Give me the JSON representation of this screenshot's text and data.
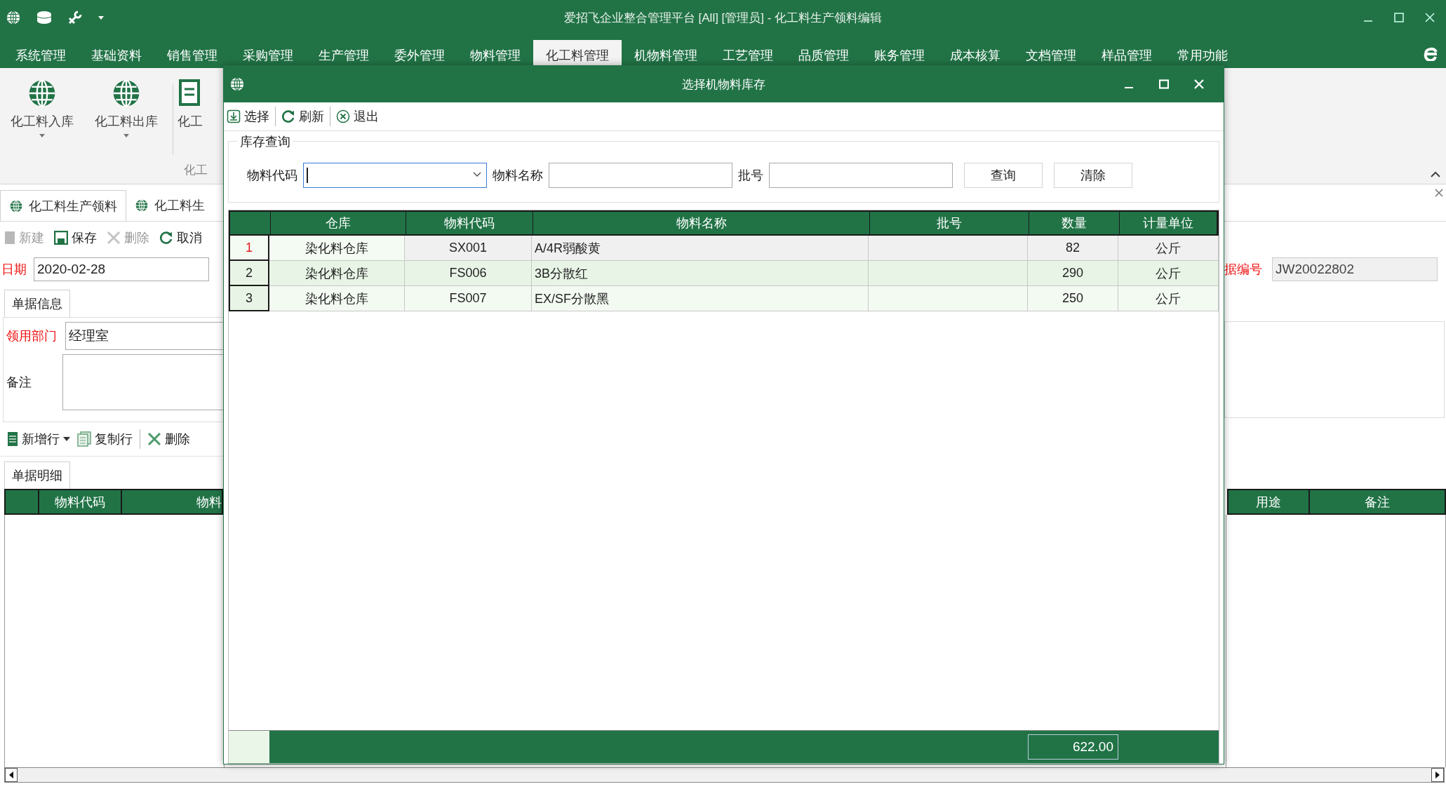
{
  "window": {
    "title": "爱招飞企业整合管理平台 [All] [管理员] - 化工料生产领料编辑"
  },
  "menu": [
    {
      "label": "系统管理",
      "selected": false
    },
    {
      "label": "基础资料",
      "selected": false
    },
    {
      "label": "销售管理",
      "selected": false
    },
    {
      "label": "采购管理",
      "selected": false
    },
    {
      "label": "生产管理",
      "selected": false
    },
    {
      "label": "委外管理",
      "selected": false
    },
    {
      "label": "物料管理",
      "selected": false
    },
    {
      "label": "化工料管理",
      "selected": true
    },
    {
      "label": "机物料管理",
      "selected": false
    },
    {
      "label": "工艺管理",
      "selected": false
    },
    {
      "label": "品质管理",
      "selected": false
    },
    {
      "label": "账务管理",
      "selected": false
    },
    {
      "label": "成本核算",
      "selected": false
    },
    {
      "label": "文档管理",
      "selected": false
    },
    {
      "label": "样品管理",
      "selected": false
    },
    {
      "label": "常用功能",
      "selected": false
    }
  ],
  "ribbon": {
    "buttons": [
      {
        "label": "化工料入库",
        "kind": "globe",
        "dropdown": true
      },
      {
        "label": "化工料出库",
        "kind": "globe",
        "dropdown": true
      },
      {
        "label": "化工",
        "kind": "document",
        "dropdown": false
      }
    ],
    "group_label": "化工"
  },
  "doc_tabs": [
    {
      "label": "化工料生产领料",
      "selected": true
    },
    {
      "label": "化工料生",
      "selected": false
    }
  ],
  "toolbar": [
    {
      "label": "新建",
      "kind": "new",
      "disabled": true
    },
    {
      "label": "保存",
      "kind": "save",
      "disabled": false
    },
    {
      "label": "删除",
      "kind": "delete",
      "disabled": true
    },
    {
      "label": "取消",
      "kind": "cancel",
      "disabled": false
    }
  ],
  "date": {
    "label": "日期",
    "value": "2020-02-28",
    "required": true
  },
  "doc_number": {
    "label": "据编号",
    "value": "JW20022802",
    "required": true
  },
  "info_tab": "单据信息",
  "department": {
    "label": "领用部门",
    "value": "经理室",
    "required": true
  },
  "remark": {
    "label": "备注",
    "required": false
  },
  "detail_toolbar": [
    {
      "label": "新增行",
      "kind": "add",
      "dropdown": true
    },
    {
      "label": "复制行",
      "kind": "copy",
      "dropdown": false
    },
    {
      "label": "删除",
      "kind": "delete",
      "dropdown": false
    }
  ],
  "detail_tab": "单据明细",
  "detail_columns_left": [
    "物料代码",
    "物料"
  ],
  "detail_columns_right": [
    "用途",
    "备注"
  ],
  "dialog": {
    "title": "选择机物料库存",
    "toolbar": [
      {
        "label": "选择",
        "kind": "select"
      },
      {
        "label": "刷新",
        "kind": "refresh"
      },
      {
        "label": "退出",
        "kind": "exit"
      }
    ],
    "group_title": "库存查询",
    "filters": [
      {
        "label": "物料代码",
        "kind": "combo",
        "focused": true
      },
      {
        "label": "物料名称",
        "kind": "text",
        "focused": false
      },
      {
        "label": "批号",
        "kind": "text",
        "focused": false
      }
    ],
    "buttons": [
      "查询",
      "清除"
    ],
    "columns": [
      "仓库",
      "物料代码",
      "物料名称",
      "批号",
      "数量",
      "计量单位"
    ],
    "rows": [
      {
        "num": "1",
        "warehouse": "染化料仓库",
        "code": "SX001",
        "name": "A/4R弱酸黄",
        "qty": "82",
        "unit": "公斤",
        "selected": true
      },
      {
        "num": "2",
        "warehouse": "染化料仓库",
        "code": "FS006",
        "name": "3B分散红",
        "qty": "290",
        "unit": "公斤",
        "selected": false
      },
      {
        "num": "3",
        "warehouse": "染化料仓库",
        "code": "FS007",
        "name": "EX/SF分散黑",
        "qty": "250",
        "unit": "公斤",
        "selected": false
      }
    ],
    "total": "622.00"
  }
}
